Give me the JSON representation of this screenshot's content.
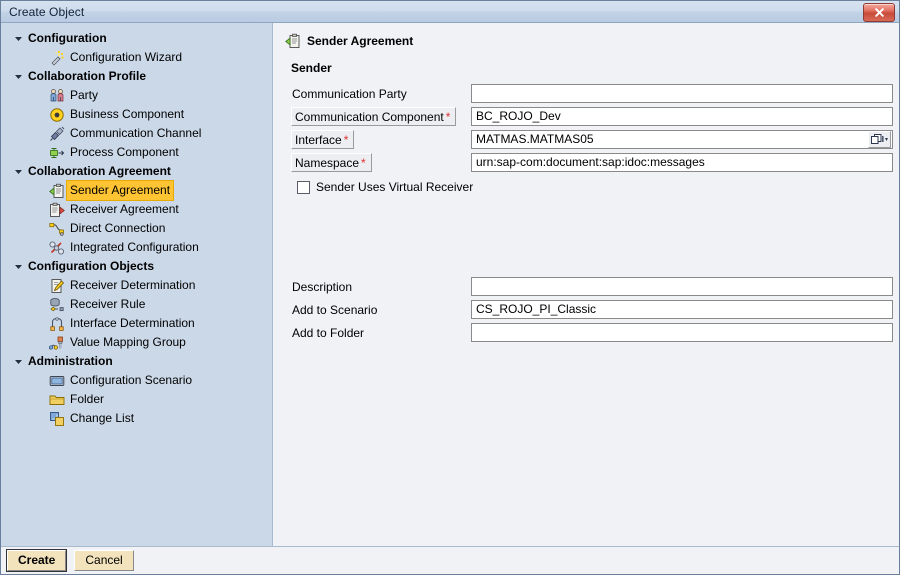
{
  "window": {
    "title": "Create Object",
    "close_label": "x",
    "close_icon": "close-icon"
  },
  "sidebar": {
    "groups": [
      {
        "label": "Configuration",
        "twisty": "chevron-down-icon",
        "items": [
          {
            "label": "Configuration Wizard",
            "icon": "magic-wand-icon",
            "selected": false
          }
        ]
      },
      {
        "label": "Collaboration Profile",
        "twisty": "chevron-down-icon",
        "items": [
          {
            "label": "Party",
            "icon": "party-people-icon",
            "selected": false
          },
          {
            "label": "Business Component",
            "icon": "business-component-icon",
            "selected": false
          },
          {
            "label": "Communication Channel",
            "icon": "communication-channel-icon",
            "selected": false
          },
          {
            "label": "Process Component",
            "icon": "process-component-icon",
            "selected": false
          }
        ]
      },
      {
        "label": "Collaboration Agreement",
        "twisty": "chevron-down-icon",
        "items": [
          {
            "label": "Sender Agreement",
            "icon": "sender-agreement-icon",
            "selected": true
          },
          {
            "label": "Receiver Agreement",
            "icon": "receiver-agreement-icon",
            "selected": false
          },
          {
            "label": "Direct Connection",
            "icon": "direct-connection-icon",
            "selected": false
          },
          {
            "label": "Integrated Configuration",
            "icon": "integrated-configuration-icon",
            "selected": false
          }
        ]
      },
      {
        "label": "Configuration Objects",
        "twisty": "chevron-down-icon",
        "items": [
          {
            "label": "Receiver Determination",
            "icon": "receiver-determination-icon",
            "selected": false
          },
          {
            "label": "Receiver Rule",
            "icon": "receiver-rule-icon",
            "selected": false
          },
          {
            "label": "Interface Determination",
            "icon": "interface-determination-icon",
            "selected": false
          },
          {
            "label": "Value Mapping Group",
            "icon": "value-mapping-group-icon",
            "selected": false
          }
        ]
      },
      {
        "label": "Administration",
        "twisty": "chevron-down-icon",
        "items": [
          {
            "label": "Configuration Scenario",
            "icon": "configuration-scenario-icon",
            "selected": false
          },
          {
            "label": "Folder",
            "icon": "folder-icon",
            "selected": false
          },
          {
            "label": "Change List",
            "icon": "change-list-icon",
            "selected": false
          }
        ]
      }
    ]
  },
  "main": {
    "panel_title": "Sender Agreement",
    "panel_title_icon": "sender-agreement-icon",
    "section_sender": "Sender",
    "fields": {
      "communication_party": {
        "label": "Communication Party",
        "value": "",
        "required": false,
        "hotspot": false
      },
      "communication_component": {
        "label": "Communication Component",
        "value": "BC_ROJO_Dev",
        "required": true,
        "required_mark": "*",
        "hotspot": true
      },
      "interface": {
        "label": "Interface",
        "value": "MATMAS.MATMAS05",
        "required": true,
        "required_mark": "*",
        "hotspot": true,
        "value_help_icon": "value-help-icon"
      },
      "namespace": {
        "label": "Namespace",
        "value": "urn:sap-com:document:sap:idoc:messages",
        "required": true,
        "required_mark": "*",
        "hotspot": true
      },
      "description": {
        "label": "Description",
        "value": "",
        "required": false,
        "hotspot": false
      },
      "add_to_scenario": {
        "label": "Add to Scenario",
        "value": "CS_ROJO_PI_Classic",
        "required": false,
        "hotspot": false
      },
      "add_to_folder": {
        "label": "Add to Folder",
        "value": "",
        "required": false,
        "hotspot": false
      }
    },
    "checkbox_virtual_receiver": {
      "label": "Sender Uses Virtual Receiver",
      "checked": false
    }
  },
  "footer": {
    "create_label": "Create",
    "cancel_label": "Cancel"
  },
  "colors": {
    "titlebar_start": "#d6e2f0",
    "titlebar_end": "#b9cbe2",
    "sidebar_bg": "#cbd8e8",
    "panel_bg": "#f1f2f6",
    "selection_highlight": "#ffc433",
    "required_asterisk": "#e03030",
    "button_face": "#f3e3bd",
    "close_button": "#c94a39"
  }
}
